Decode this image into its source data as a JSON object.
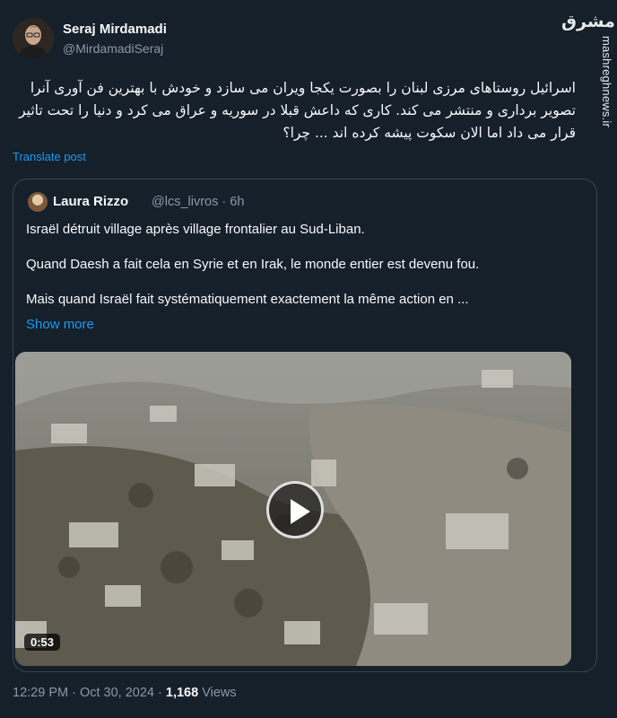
{
  "author": {
    "name": "Seraj Mirdamadi",
    "handle": "@MirdamadiSeraj"
  },
  "watermark": {
    "logo_text": "مشرق",
    "site": "mashreghnews.ir"
  },
  "tweet": {
    "text": "اسرائیل روستاهای مرزی لبنان را بصورت یکجا ویران می سازد و خودش با بهترین فن آوری آنرا تصویر برداری و منتشر می کند. کاری که داعش قبلا در سوریه و عراق می کرد و دنیا را تحت تاثیر قرار می داد اما الان سکوت پیشه کرده اند ... چرا؟",
    "translate_label": "Translate post"
  },
  "quoted": {
    "name": "Laura Rizzo",
    "handle": "@lcs_livros",
    "separator": "·",
    "time": "6h",
    "paragraphs": [
      "Israël détruit village après village frontalier au Sud-Liban.",
      "Quand Daesh a fait cela en Syrie et en Irak, le monde entier est devenu fou.",
      "Mais quand Israël fait systématiquement exactement la même action en ..."
    ],
    "show_more": "Show more",
    "video": {
      "duration": "0:53",
      "play_icon": "play-icon"
    }
  },
  "footer": {
    "time": "12:29 PM",
    "separator1": " · ",
    "date": "Oct 30, 2024",
    "separator2": " · ",
    "views_count": "1,168",
    "views_label": " Views"
  },
  "colors": {
    "background": "#15202b",
    "accent": "#1d9bf0",
    "muted": "#8b98a5",
    "border": "#38444d"
  }
}
